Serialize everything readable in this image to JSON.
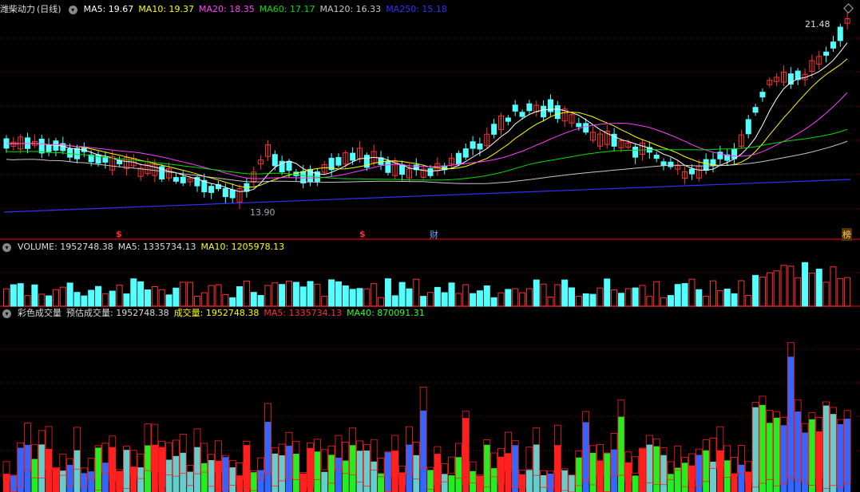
{
  "main_panel": {
    "stock_title": "潍柴动力",
    "period_label": "(日线)",
    "ma_values": [
      {
        "label": "MA5: 19.67",
        "color": "#ffffff"
      },
      {
        "label": "MA10: 19.37",
        "color": "#ffff00"
      },
      {
        "label": "MA20: 18.35",
        "color": "#ff40ff"
      },
      {
        "label": "MA60: 17.17",
        "color": "#00e000"
      },
      {
        "label": "MA120: 16.33",
        "color": "#c8c8c8"
      },
      {
        "label": "MA250: 15.18",
        "color": "#3030ff"
      }
    ],
    "high_label": "21.48",
    "low_label": "13.90",
    "markers": [
      {
        "text": "$",
        "color": "#ff3030"
      },
      {
        "text": "$",
        "color": "#ff3030"
      },
      {
        "text": "财",
        "color": "#66aaff"
      },
      {
        "text": "榜",
        "color": "#ffcc66"
      }
    ]
  },
  "volume_panel": {
    "title": "VOLUME: 1952748.38",
    "ma5": "MA5: 1335734.13",
    "ma10": "MA10: 1205978.13"
  },
  "color_volume_panel": {
    "title": "彩色成交量",
    "estimate": "预估成交量: 1952748.38",
    "volume": "成交量: 1952748.38",
    "ma5": "MA5: 1335734.13",
    "ma40": "MA40: 870091.31"
  },
  "colors": {
    "up": "#ff3232",
    "down": "#54ffff",
    "grid": "#8b0000",
    "ma5": "#ffffff",
    "ma10": "#ffff00",
    "ma20": "#ff40ff",
    "ma60": "#00e000",
    "ma120": "#c8c8c8",
    "ma250": "#3030ff"
  }
}
